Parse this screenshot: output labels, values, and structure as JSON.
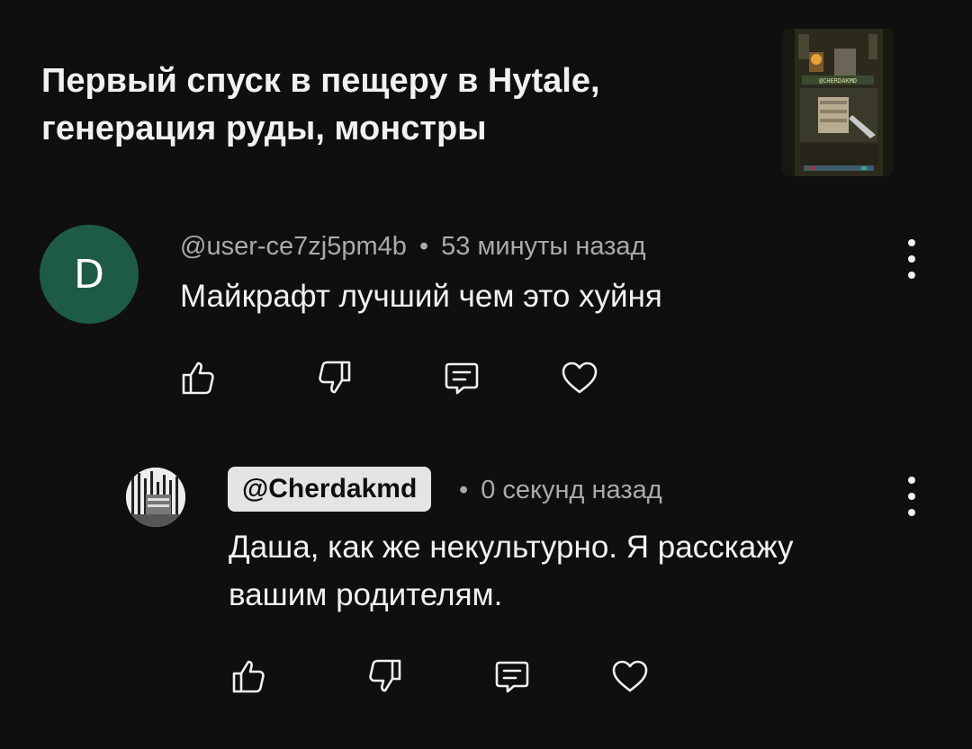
{
  "video": {
    "title_line1": "Первый спуск в пещеру в Hytale,",
    "title_line2": "генерация руды, монстры",
    "thumbnail_caption": "@CHERDAKMD"
  },
  "comment": {
    "avatar_letter": "D",
    "avatar_color": "#1e5a48",
    "author": "@user-ce7zj5pm4b",
    "separator": "•",
    "time": "53 минуты назад",
    "text": "Майкрафт лучший чем это хуйня",
    "actions": [
      "thumb-up-icon",
      "thumb-down-icon",
      "reply-icon",
      "heart-icon"
    ]
  },
  "reply": {
    "author": "@Cherdakmd",
    "separator": "•",
    "time": "0 секунд назад",
    "text_line1": "Даша, как же некультурно. Я расскажу",
    "text_line2": "вашим родителям.",
    "actions": [
      "thumb-up-icon",
      "thumb-down-icon",
      "reply-icon",
      "heart-icon"
    ]
  },
  "colors": {
    "background": "#0f0f0f",
    "text_primary": "#f1f1f1",
    "text_secondary": "#aaaaaa",
    "chip_bg": "#e4e4e4"
  }
}
